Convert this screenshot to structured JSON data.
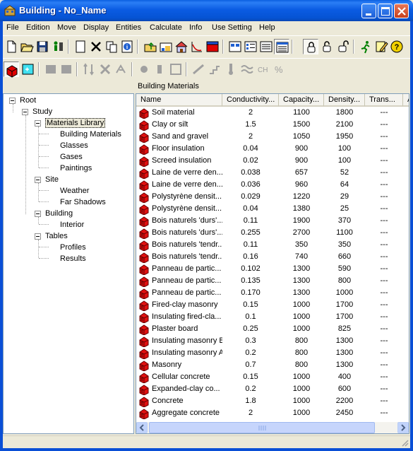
{
  "window": {
    "title": "Building - No_Name",
    "app_icon": "building-app-icon"
  },
  "menu": [
    "File",
    "Edition",
    "Move",
    "Display",
    "Entities",
    "Calculate",
    "Info",
    "Use Setting",
    "Help"
  ],
  "tree": {
    "nodes": [
      {
        "label": "Root"
      },
      {
        "label": "Study"
      },
      {
        "label": "Materials Library"
      },
      {
        "label": "Building Materials"
      },
      {
        "label": "Glasses"
      },
      {
        "label": "Gases"
      },
      {
        "label": "Paintings"
      },
      {
        "label": "Site"
      },
      {
        "label": "Weather"
      },
      {
        "label": "Far Shadows"
      },
      {
        "label": "Building"
      },
      {
        "label": "Interior"
      },
      {
        "label": "Tables"
      },
      {
        "label": "Profiles"
      },
      {
        "label": "Results"
      }
    ]
  },
  "panel": {
    "title": "Building Materials",
    "columns": [
      "Name",
      "Conductivity...",
      "Capacity...",
      "Density...",
      "Trans...",
      "A"
    ],
    "rows": [
      [
        "Soil material",
        "2",
        "1100",
        "1800",
        "---"
      ],
      [
        "Clay or silt",
        "1.5",
        "1500",
        "2100",
        "---"
      ],
      [
        "Sand and gravel",
        "2",
        "1050",
        "1950",
        "---"
      ],
      [
        "Floor insulation",
        "0.04",
        "900",
        "100",
        "---"
      ],
      [
        "Screed insulation",
        "0.02",
        "900",
        "100",
        "---"
      ],
      [
        "Laine de verre den...",
        "0.038",
        "657",
        "52",
        "---"
      ],
      [
        "Laine de verre den...",
        "0.036",
        "960",
        "64",
        "---"
      ],
      [
        "Polystyrène densit...",
        "0.029",
        "1220",
        "29",
        "---"
      ],
      [
        "Polystyrène densit...",
        "0.04",
        "1380",
        "25",
        "---"
      ],
      [
        "Bois naturels 'durs'...",
        "0.11",
        "1900",
        "370",
        "---"
      ],
      [
        "Bois naturels 'durs'...",
        "0.255",
        "2700",
        "1100",
        "---"
      ],
      [
        "Bois naturels 'tendr...",
        "0.11",
        "350",
        "350",
        "---"
      ],
      [
        "Bois naturels 'tendr...",
        "0.16",
        "740",
        "660",
        "---"
      ],
      [
        "Panneau de partic...",
        "0.102",
        "1300",
        "590",
        "---"
      ],
      [
        "Panneau de partic...",
        "0.135",
        "1300",
        "800",
        "---"
      ],
      [
        "Panneau de partic...",
        "0.170",
        "1300",
        "1000",
        "---"
      ],
      [
        "Fired-clay masonry",
        "0.15",
        "1000",
        "1700",
        "---"
      ],
      [
        "Insulating fired-cla...",
        "0.1",
        "1000",
        "1700",
        "---"
      ],
      [
        "Plaster board",
        "0.25",
        "1000",
        "825",
        "---"
      ],
      [
        "Insulating masonry B",
        "0.3",
        "800",
        "1300",
        "---"
      ],
      [
        "Insulating masonry A",
        "0.2",
        "800",
        "1300",
        "---"
      ],
      [
        "Masonry",
        "0.7",
        "800",
        "1300",
        "---"
      ],
      [
        "Cellular concrete",
        "0.15",
        "1000",
        "400",
        "---"
      ],
      [
        "Expanded-clay co...",
        "0.2",
        "1000",
        "600",
        "---"
      ],
      [
        "Concrete",
        "1.8",
        "1000",
        "2200",
        "---"
      ],
      [
        "Aggregate concrete",
        "2",
        "1000",
        "2450",
        "---"
      ]
    ]
  },
  "colors": {
    "titlebar": "#0a5fe0",
    "material_icon": "#e01010",
    "window_bg": "#ece9d8"
  }
}
